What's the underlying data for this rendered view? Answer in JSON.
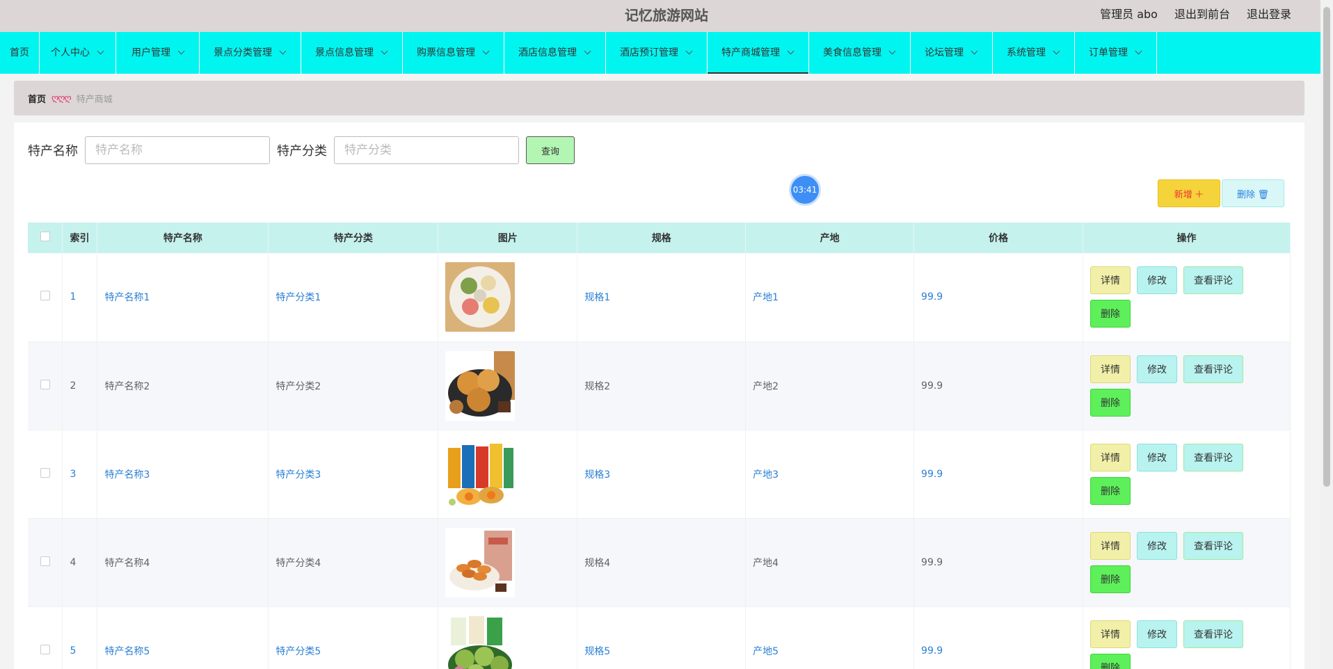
{
  "header": {
    "site_title": "记忆旅游网站",
    "admin_label": "管理员 abo",
    "to_front_label": "退出到前台",
    "logout_label": "退出登录"
  },
  "nav": {
    "items": [
      {
        "label": "首页",
        "has_dropdown": false
      },
      {
        "label": "个人中心",
        "has_dropdown": true
      },
      {
        "label": "用户管理",
        "has_dropdown": true
      },
      {
        "label": "景点分类管理",
        "has_dropdown": true
      },
      {
        "label": "景点信息管理",
        "has_dropdown": true
      },
      {
        "label": "购票信息管理",
        "has_dropdown": true
      },
      {
        "label": "酒店信息管理",
        "has_dropdown": true
      },
      {
        "label": "酒店预订管理",
        "has_dropdown": true
      },
      {
        "label": "特产商城管理",
        "has_dropdown": true,
        "active": true
      },
      {
        "label": "美食信息管理",
        "has_dropdown": true
      },
      {
        "label": "论坛管理",
        "has_dropdown": true
      },
      {
        "label": "系统管理",
        "has_dropdown": true
      },
      {
        "label": "订单管理",
        "has_dropdown": true
      }
    ],
    "bg_color": "#00f5f0"
  },
  "breadcrumb": {
    "home": "首页",
    "separator": "ღღღ",
    "current": "特产商城"
  },
  "search": {
    "name_label": "特产名称",
    "name_placeholder": "特产名称",
    "category_label": "特产分类",
    "category_placeholder": "特产分类",
    "query_button": "查询"
  },
  "timer": "03:41",
  "actions": {
    "add_label": "新增 ＋",
    "delete_label": "删除 🗑"
  },
  "table": {
    "columns": [
      "索引",
      "特产名称",
      "特产分类",
      "图片",
      "规格",
      "产地",
      "价格",
      "操作"
    ],
    "row_buttons": {
      "detail": "详情",
      "edit": "修改",
      "comments": "查看评论",
      "delete": "删除"
    },
    "rows": [
      {
        "index": "1",
        "name": "特产名称1",
        "category": "特产分类1",
        "spec": "规格1",
        "origin": "产地1",
        "price": "99.9",
        "image": "mooncakes-plate"
      },
      {
        "index": "2",
        "name": "特产名称2",
        "category": "特产分类2",
        "spec": "规格2",
        "origin": "产地2",
        "price": "99.9",
        "image": "sesame-cakes"
      },
      {
        "index": "3",
        "name": "特产名称3",
        "category": "特产分类3",
        "spec": "规格3",
        "origin": "产地3",
        "price": "99.9",
        "image": "gift-boxes"
      },
      {
        "index": "4",
        "name": "特产名称4",
        "category": "特产分类4",
        "spec": "规格4",
        "origin": "产地4",
        "price": "99.9",
        "image": "twisted-dough"
      },
      {
        "index": "5",
        "name": "特产名称5",
        "category": "特产分类5",
        "spec": "规格5",
        "origin": "产地5",
        "price": "99.9",
        "image": "green-cakes"
      }
    ]
  }
}
